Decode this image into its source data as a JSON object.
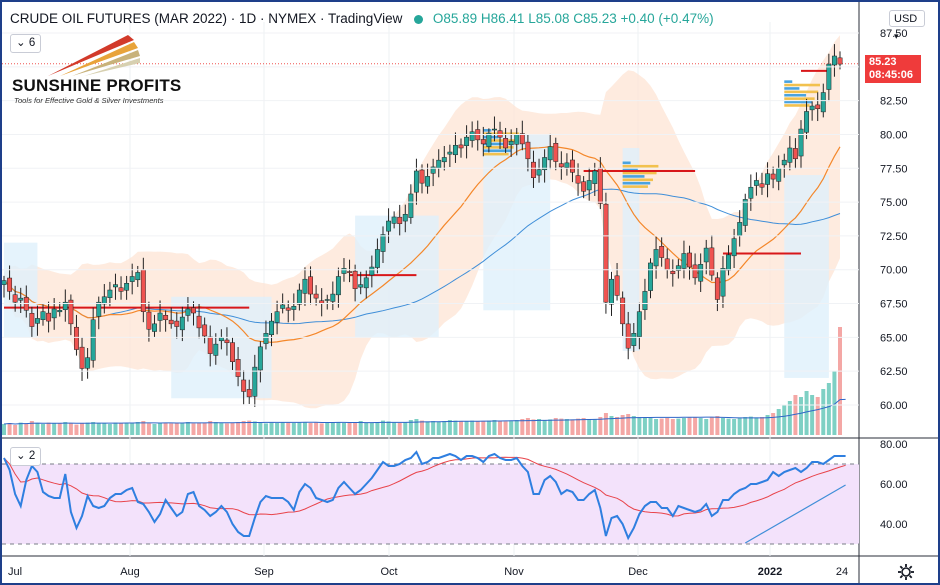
{
  "header": {
    "title": "CRUDE OIL FUTURES (MAR 2022) · 1D · NYMEX · TradingView",
    "ohlc": "O85.89 H86.41 L85.08 C85.23 +0.40 (+0.47%)"
  },
  "indicator_badges": {
    "main": "6",
    "rsi": "2"
  },
  "currency": "USD",
  "logo": {
    "name": "SUNSHINE PROFITS",
    "tagline": "Tools for Effective Gold & Silver Investments"
  },
  "last_price": {
    "value": "85.23",
    "countdown": "08:45:06"
  },
  "colors": {
    "up": "#26a69a",
    "down": "#ef5350",
    "ma_short": "#f4872a",
    "ma_long": "#3f8ed8",
    "rsi": "#2f7fe0",
    "rsi_ma": "#e8434a",
    "band_fill": "#fde4d4",
    "rsi_zone": "#f3e2fb",
    "frame": "#1e3f8a",
    "level": "#d8171a"
  },
  "chart_data": [
    {
      "type": "candlestick",
      "title": "CRUDE OIL FUTURES (MAR 2022)",
      "ylim": [
        58.5,
        88.0
      ],
      "y_ticks": [
        "87.50",
        "85.00",
        "82.50",
        "80.00",
        "77.50",
        "75.00",
        "72.50",
        "70.00",
        "67.50",
        "65.00",
        "62.50",
        "60.00"
      ],
      "x_ticks": [
        "Jul",
        "Aug",
        "Sep",
        "Oct",
        "Nov",
        "Dec",
        "2022",
        "24"
      ],
      "resistance_levels": [
        67.2,
        69.6,
        77.3,
        71.2,
        84.7
      ],
      "close": [
        69.2,
        68.4,
        67.6,
        67.9,
        67.0,
        65.8,
        66.4,
        66.9,
        66.2,
        67.1,
        67.0,
        67.6,
        66.0,
        64.1,
        62.7,
        63.5,
        66.3,
        67.6,
        68.0,
        68.5,
        68.9,
        68.4,
        69.0,
        69.5,
        69.8,
        66.9,
        65.6,
        66.0,
        66.8,
        66.3,
        66.0,
        65.8,
        66.5,
        67.1,
        66.8,
        65.7,
        65.1,
        63.8,
        64.5,
        65.0,
        64.6,
        63.2,
        62.1,
        61.0,
        60.6,
        62.8,
        64.3,
        65.3,
        66.2,
        66.9,
        67.4,
        67.0,
        67.3,
        68.5,
        69.3,
        68.2,
        67.9,
        67.5,
        67.8,
        68.2,
        69.5,
        70.1,
        69.8,
        68.6,
        68.9,
        69.4,
        70.2,
        71.5,
        72.6,
        73.6,
        73.9,
        73.4,
        74.1,
        75.6,
        77.3,
        76.4,
        76.9,
        77.6,
        78.1,
        78.3,
        78.7,
        79.2,
        79.0,
        79.8,
        80.2,
        79.6,
        79.3,
        80.1,
        80.4,
        79.8,
        79.0,
        79.5,
        80.0,
        79.3,
        78.2,
        76.8,
        77.4,
        78.3,
        79.1,
        78.0,
        77.6,
        77.9,
        77.2,
        76.4,
        75.8,
        76.6,
        77.3,
        74.9,
        67.6,
        69.3,
        68.1,
        66.0,
        64.2,
        65.3,
        66.9,
        68.4,
        70.5,
        71.5,
        70.9,
        70.0,
        69.7,
        70.3,
        71.2,
        70.2,
        69.4,
        70.4,
        71.6,
        69.6,
        67.8,
        70.1,
        71.1,
        72.3,
        73.5,
        75.2,
        76.1,
        76.6,
        76.1,
        77.1,
        76.7,
        77.5,
        78.1,
        79.0,
        78.2,
        80.4,
        81.7,
        82.1,
        81.9,
        83.1,
        85.2,
        85.8,
        85.2
      ],
      "volume": [
        0.55,
        0.6,
        0.5,
        0.62,
        0.58,
        0.7,
        0.6,
        0.55,
        0.62,
        0.58,
        0.6,
        0.65,
        0.58,
        0.52,
        0.6,
        0.62,
        0.65,
        0.58,
        0.6,
        0.55,
        0.62,
        0.6,
        0.58,
        0.62,
        0.65,
        0.7,
        0.58,
        0.55,
        0.6,
        0.62,
        0.58,
        0.6,
        0.62,
        0.65,
        0.58,
        0.6,
        0.62,
        0.7,
        0.65,
        0.6,
        0.58,
        0.62,
        0.65,
        0.7,
        0.72,
        0.68,
        0.6,
        0.58,
        0.62,
        0.6,
        0.65,
        0.62,
        0.6,
        0.62,
        0.65,
        0.6,
        0.62,
        0.58,
        0.6,
        0.62,
        0.65,
        0.6,
        0.62,
        0.65,
        0.7,
        0.62,
        0.6,
        0.65,
        0.72,
        0.68,
        0.62,
        0.6,
        0.65,
        0.75,
        0.8,
        0.72,
        0.68,
        0.7,
        0.65,
        0.7,
        0.75,
        0.72,
        0.7,
        0.68,
        0.72,
        0.7,
        0.68,
        0.72,
        0.75,
        0.7,
        0.68,
        0.72,
        0.75,
        0.8,
        0.85,
        0.78,
        0.8,
        0.75,
        0.78,
        0.85,
        0.82,
        0.8,
        0.78,
        0.82,
        0.85,
        0.8,
        0.78,
        0.9,
        1.1,
        0.95,
        0.9,
        1.0,
        1.05,
        0.95,
        0.9,
        0.88,
        0.85,
        0.8,
        0.82,
        0.85,
        0.8,
        0.82,
        0.85,
        0.9,
        0.88,
        0.85,
        0.8,
        0.9,
        0.95,
        0.85,
        0.82,
        0.8,
        0.85,
        0.9,
        0.92,
        0.88,
        0.9,
        1.0,
        1.1,
        1.3,
        1.5,
        1.7,
        2.0,
        1.9,
        2.2,
        2.0,
        1.9,
        2.3,
        2.6,
        3.2,
        5.4,
        1.1
      ]
    },
    {
      "type": "line",
      "title": "RSI",
      "ylim": [
        25,
        82
      ],
      "y_ticks": [
        "80.00",
        "60.00",
        "40.00"
      ],
      "guides": [
        70,
        30
      ],
      "rsi": [
        73,
        67,
        55,
        49,
        62,
        69,
        66,
        56,
        54,
        53,
        53,
        65,
        46,
        38,
        44,
        54,
        49,
        48,
        49,
        53,
        55,
        55,
        57,
        58,
        51,
        50,
        46,
        41,
        45,
        52,
        48,
        44,
        46,
        55,
        56,
        49,
        47,
        44,
        46,
        49,
        46,
        40,
        36,
        34,
        34,
        43,
        51,
        54,
        53,
        53,
        53,
        51,
        47,
        56,
        60,
        58,
        53,
        52,
        51,
        52,
        58,
        61,
        58,
        55,
        57,
        60,
        63,
        67,
        71,
        69,
        69,
        70,
        72,
        73,
        76,
        70,
        71,
        73,
        73,
        74,
        75,
        74,
        72,
        74,
        74,
        73,
        71,
        74,
        75,
        73,
        72,
        72,
        73,
        69,
        66,
        55,
        55,
        62,
        64,
        61,
        55,
        57,
        56,
        52,
        52,
        55,
        57,
        48,
        34,
        43,
        44,
        40,
        33,
        38,
        45,
        49,
        51,
        51,
        48,
        48,
        44,
        49,
        48,
        47,
        46,
        47,
        50,
        44,
        46,
        52,
        52,
        55,
        57,
        58,
        60,
        60,
        61,
        62,
        66,
        64,
        66,
        67,
        68,
        66,
        68,
        71,
        71,
        70,
        72,
        74,
        74,
        74
      ],
      "trendline": [
        [
          133,
          30.5
        ],
        [
          151,
          59.5
        ]
      ]
    }
  ]
}
